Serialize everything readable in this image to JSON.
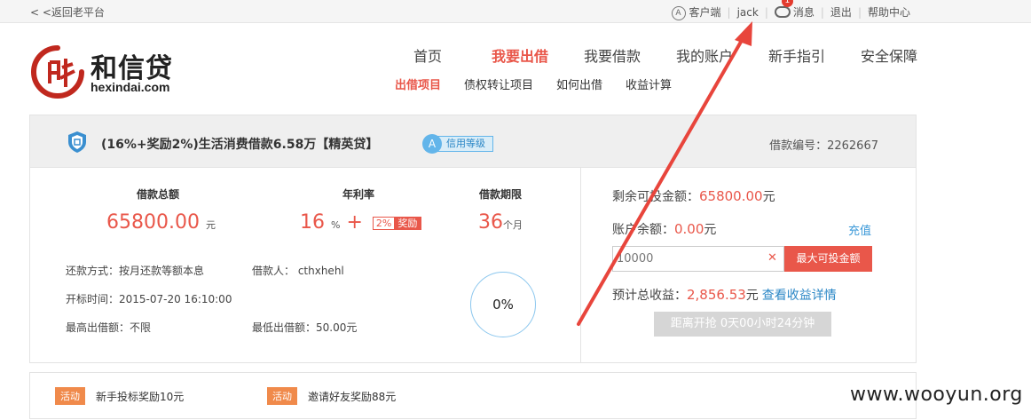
{
  "topbar": {
    "back_label": "< <返回老平台",
    "client_label": "客户端",
    "username": "jack",
    "message_badge": "1",
    "message_label": "消息",
    "logout_label": "退出",
    "help_label": "帮助中心"
  },
  "logo": {
    "cn": "和信贷",
    "en": "hexindai.com"
  },
  "nav": {
    "items": [
      "首页",
      "我要出借",
      "我要借款",
      "我的账户",
      "新手指引",
      "安全保障"
    ],
    "active_index": 1
  },
  "subnav": {
    "items": [
      "出借项目",
      "债权转让项目",
      "如何出借",
      "收益计算"
    ],
    "active_index": 0
  },
  "loan": {
    "title": "(16%+奖励2%)生活消费借款6.58万【精英贷】",
    "credit_grade": "A",
    "credit_label": "信用等级",
    "loan_no": "借款编号：2262667",
    "total_label": "借款总额",
    "total_value": "65800.00",
    "total_unit": "元",
    "rate_label": "年利率",
    "rate_value": "16",
    "rate_unit": "%",
    "rate_plus": "+",
    "bonus_pct": "2%",
    "bonus_label": "奖励",
    "term_label": "借款期限",
    "term_value": "36",
    "term_unit": "个月",
    "repay_method": "还款方式：按月还款等额本息",
    "borrower": "借款人： cthxhehl",
    "open_time": "开标时间：2015-07-20 16:10:00",
    "max_bid": "最高出借额：不限",
    "min_bid": "最低出借额：50.00元",
    "progress_label": "0%",
    "progress_fraction": 0
  },
  "invest": {
    "remaining_label": "剩余可投金额：",
    "remaining_value": "65800.00",
    "remaining_unit": "元",
    "balance_label": "账户余额：",
    "balance_value": "0.00",
    "balance_unit": "元",
    "recharge_label": "充值",
    "amount_value": "10000",
    "clear_symbol": "✕",
    "max_button": "最大可投金额",
    "expected_label": "预计总收益：",
    "expected_value": "2,856.53",
    "expected_unit": "元",
    "expected_link": "查看收益详情",
    "countdown": "距离开抢 0天00小时24分钟"
  },
  "activities": [
    {
      "tag": "活动",
      "text": "新手投标奖励10元"
    },
    {
      "tag": "活动",
      "text": "邀请好友奖励88元"
    }
  ],
  "watermark": "www.wooyun.org",
  "colors": {
    "accent_red": "#e9574a",
    "link_blue": "#2b87c6",
    "activity_orange": "#f08a4b",
    "arrow_red": "#e8453c"
  }
}
